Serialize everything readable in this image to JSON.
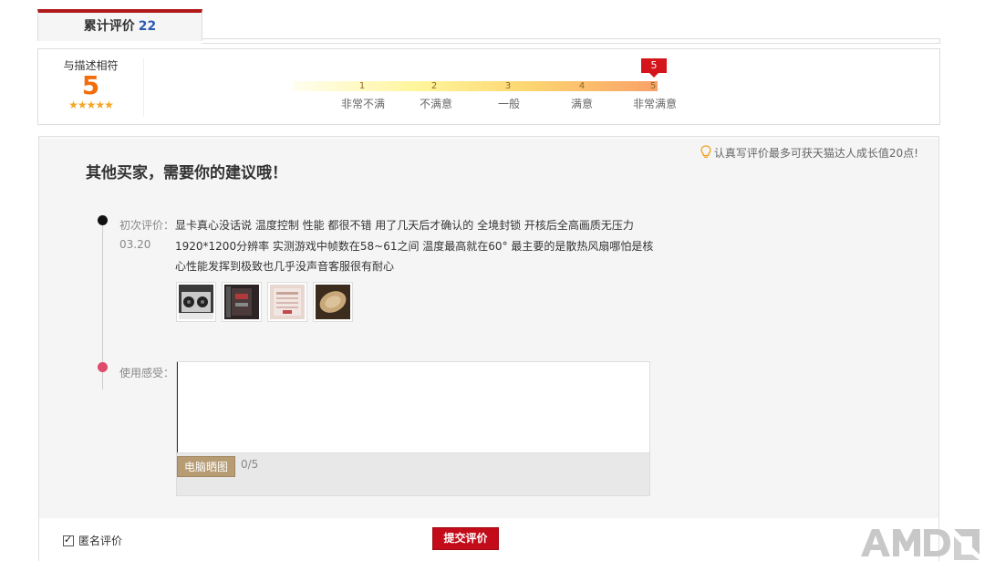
{
  "tab": {
    "label": "累计评价",
    "count": "22"
  },
  "score": {
    "label": "与描述相符",
    "value": "5",
    "stars": "★★★★★",
    "ticks": [
      "1",
      "2",
      "3",
      "4",
      "5"
    ],
    "tick_labels": [
      "非常不满",
      "不满意",
      "一般",
      "满意",
      "非常满意"
    ],
    "selected": "5"
  },
  "main": {
    "tip": "认真写评价最多可获天猫达人成长值20点!",
    "heading": "其他买家，需要你的建议哦！",
    "first_review_label": "初次评价：",
    "first_review_date": "03.20",
    "first_review_text": "显卡真心没话说 温度控制 性能 都很不错 用了几天后才确认的 全境封锁 开核后全高画质无压力 1920*1200分辨率 实测游戏中帧数在58~61之间 温度最高就在60° 最主要的是散热风扇哪怕是核心性能发挥到极致也几乎没声音客服很有耐心",
    "usage_label": "使用感受：",
    "textarea_value": "",
    "pc_photo_button": "电脑晒图",
    "char_counter": "0/5"
  },
  "bottom": {
    "anonymous_label": "匿名评价",
    "anonymous_checked": true,
    "submit_label": "提交评价"
  },
  "colors": {
    "accent_red": "#b1191a",
    "score_orange": "#f26d0c",
    "submit_red": "#c30b1a"
  }
}
